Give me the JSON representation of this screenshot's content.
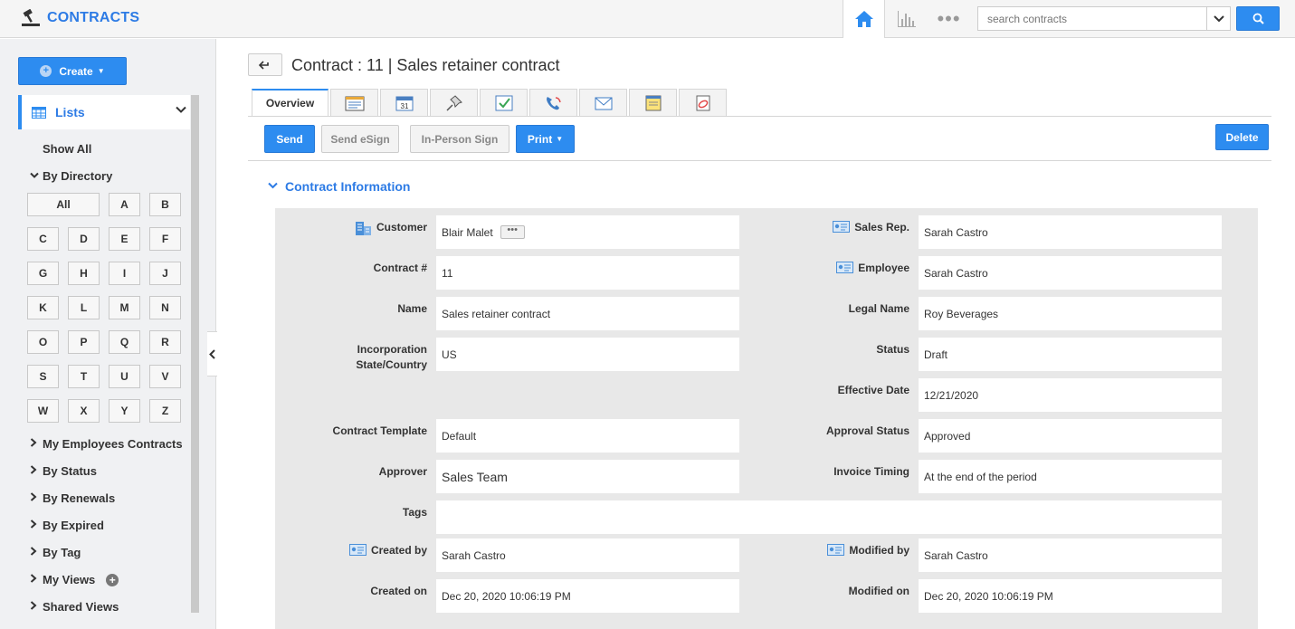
{
  "app": {
    "title": "CONTRACTS"
  },
  "search": {
    "placeholder": "search contracts"
  },
  "sidebar": {
    "create_label": "Create",
    "lists_label": "Lists",
    "show_all": "Show All",
    "by_directory": "By Directory",
    "letters": [
      "All",
      "A",
      "B",
      "C",
      "D",
      "E",
      "F",
      "G",
      "H",
      "I",
      "J",
      "K",
      "L",
      "M",
      "N",
      "O",
      "P",
      "Q",
      "R",
      "S",
      "T",
      "U",
      "V",
      "W",
      "X",
      "Y",
      "Z"
    ],
    "groups": [
      "My Employees Contracts",
      "By Status",
      "By Renewals",
      "By Expired",
      "By Tag",
      "My Views",
      "Shared Views"
    ]
  },
  "page": {
    "title": "Contract : 11 | Sales retainer contract"
  },
  "tabs": {
    "overview": "Overview"
  },
  "actions": {
    "send": "Send",
    "send_esign": "Send eSign",
    "in_person_sign": "In-Person Sign",
    "print": "Print",
    "delete": "Delete"
  },
  "section": {
    "title": "Contract Information"
  },
  "fields": {
    "customer": {
      "label": "Customer",
      "value": "Blair Malet"
    },
    "sales_rep": {
      "label": "Sales Rep.",
      "value": "Sarah Castro"
    },
    "contract_no": {
      "label": "Contract #",
      "value": "11"
    },
    "employee": {
      "label": "Employee",
      "value": "Sarah Castro"
    },
    "name": {
      "label": "Name",
      "value": "Sales retainer contract"
    },
    "legal_name": {
      "label": "Legal Name",
      "value": "Roy Beverages"
    },
    "incorporation": {
      "label_line1": "Incorporation",
      "label_line2": "State/Country",
      "value": "US"
    },
    "status": {
      "label": "Status",
      "value": "Draft"
    },
    "effective_date": {
      "label": "Effective Date",
      "value": "12/21/2020"
    },
    "contract_template": {
      "label": "Contract Template",
      "value": "Default"
    },
    "approval_status": {
      "label": "Approval Status",
      "value": "Approved"
    },
    "approver": {
      "label": "Approver",
      "value": "Sales Team"
    },
    "invoice_timing": {
      "label": "Invoice Timing",
      "value": "At the end of the period"
    },
    "tags": {
      "label": "Tags",
      "value": ""
    },
    "created_by": {
      "label": "Created by",
      "value": "Sarah Castro"
    },
    "modified_by": {
      "label": "Modified by",
      "value": "Sarah Castro"
    },
    "created_on": {
      "label": "Created on",
      "value": "Dec 20, 2020 10:06:19 PM"
    },
    "modified_on": {
      "label": "Modified on",
      "value": "Dec 20, 2020 10:06:19 PM"
    }
  },
  "colors": {
    "accent": "#2d8cf0",
    "brand_text": "#2d7be5",
    "panel": "#e8e8e8",
    "sidebar_bg": "#f0f1f3"
  }
}
